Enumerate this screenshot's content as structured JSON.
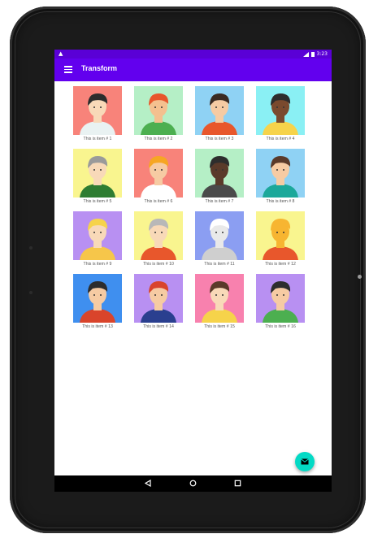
{
  "status_bar": {
    "time": "3:23",
    "warning_icon": "warning-icon",
    "signal_icon": "signal-icon",
    "battery_icon": "battery-icon"
  },
  "app_bar": {
    "title": "Transform",
    "menu_icon": "hamburger-menu-icon"
  },
  "items": [
    {
      "label": "This is item # 1",
      "bg": "#f8837a"
    },
    {
      "label": "This is item # 2",
      "bg": "#b5efc6"
    },
    {
      "label": "This is item # 3",
      "bg": "#8fd2f4"
    },
    {
      "label": "This is item # 4",
      "bg": "#8af0f4"
    },
    {
      "label": "This is item # 5",
      "bg": "#f9f58f"
    },
    {
      "label": "This is item # 6",
      "bg": "#f8837a"
    },
    {
      "label": "This is item # 7",
      "bg": "#b5efc6"
    },
    {
      "label": "This is item # 8",
      "bg": "#8fd2f4"
    },
    {
      "label": "This is item # 9",
      "bg": "#b890f2"
    },
    {
      "label": "This is item # 10",
      "bg": "#f9f58f"
    },
    {
      "label": "This is item # 11",
      "bg": "#8b9ef2"
    },
    {
      "label": "This is item # 12",
      "bg": "#f9f58f"
    },
    {
      "label": "This is item # 13",
      "bg": "#3f8fef"
    },
    {
      "label": "This is item # 14",
      "bg": "#b890f2"
    },
    {
      "label": "This is item # 15",
      "bg": "#f881ae"
    },
    {
      "label": "This is item # 16",
      "bg": "#b890f2"
    }
  ],
  "fab": {
    "icon": "email-icon"
  },
  "nav_bar": {
    "back_icon": "back-icon",
    "home_icon": "home-icon",
    "recents_icon": "recents-icon"
  },
  "colors": {
    "status_bar": "#5a00d6",
    "app_bar": "#6200ee",
    "fab": "#03dac5"
  }
}
